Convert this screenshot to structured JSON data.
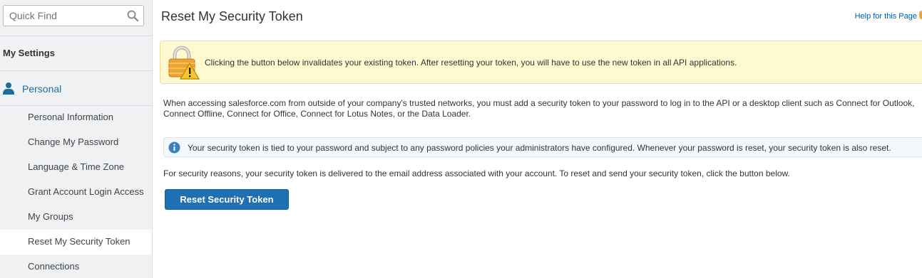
{
  "sidebar": {
    "quick_find": {
      "placeholder": "Quick Find",
      "value": ""
    },
    "section_title": "My Settings",
    "group_label": "Personal",
    "items": [
      {
        "label": "Personal Information"
      },
      {
        "label": "Change My Password"
      },
      {
        "label": "Language & Time Zone"
      },
      {
        "label": "Grant Account Login Access"
      },
      {
        "label": "My Groups"
      },
      {
        "label": "Reset My Security Token"
      },
      {
        "label": "Connections"
      }
    ],
    "active_item": "Reset My Security Token"
  },
  "main": {
    "title": "Reset My Security Token",
    "help_link": "Help for this Page",
    "warning": "Clicking the button below invalidates your existing token. After resetting your token, you will have to use the new token in all API applications.",
    "intro_line1": "When accessing salesforce.com from outside of your company's trusted networks, you must add a security token to your password to log in to the API or a desktop client such as Connect for Outlook,",
    "intro_line2": "Connect Offline, Connect for Office, Connect for Lotus Notes, or the Data Loader.",
    "info": "Your security token is tied to your password and subject to any password policies your administrators have configured. Whenever your password is reset, your security token is also reset.",
    "note": "For security reasons, your security token is delivered to the email address associated with your account. To reset and send your security token, click the button below.",
    "reset_button": "Reset Security Token"
  },
  "colors": {
    "accent": "#1f6fb3",
    "link": "#015ba7",
    "warning_bg": "#fff9d0",
    "info_bg": "#f3f8fc",
    "sidebar_bg": "#f0f1f2"
  },
  "icons": [
    "search-icon",
    "person-icon",
    "lock-warning-icon",
    "info-icon"
  ]
}
